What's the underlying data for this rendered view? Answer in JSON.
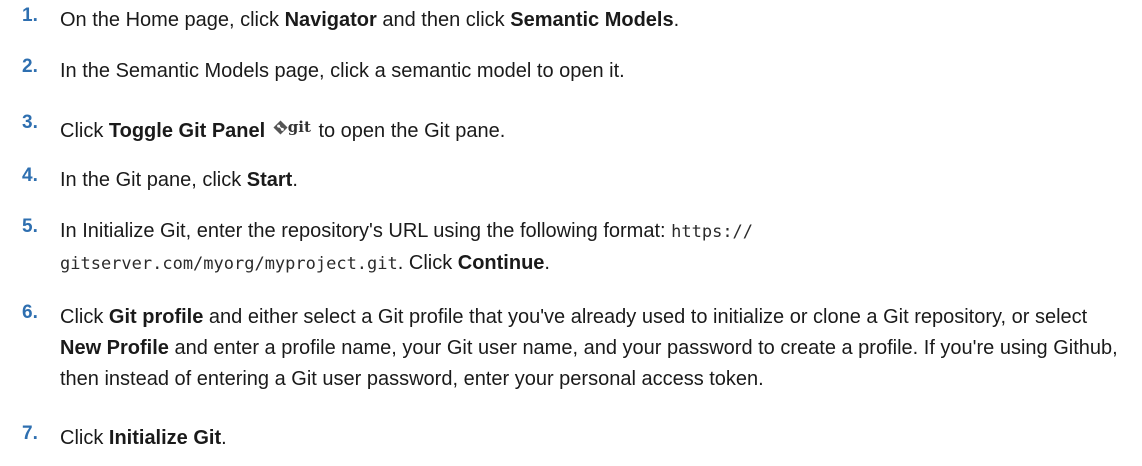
{
  "steps": [
    {
      "num": "1.",
      "parts": [
        "On the Home page, click ",
        "Navigator",
        " and then click ",
        "Semantic Models",
        "."
      ]
    },
    {
      "num": "2.",
      "text": "In the Semantic Models page, click a semantic model to open it."
    },
    {
      "num": "3.",
      "parts": [
        "Click ",
        "Toggle Git Panel",
        " to open the Git pane."
      ],
      "icon_label": "git",
      "icon": "git-diamond-icon"
    },
    {
      "num": "4.",
      "parts": [
        "In the Git pane, click ",
        "Start",
        "."
      ]
    },
    {
      "num": "5.",
      "parts": [
        "In Initialize Git, enter the repository's URL using the following format: ",
        "https://",
        "gitserver.com/myorg/myproject.git",
        ". Click ",
        "Continue",
        "."
      ]
    },
    {
      "num": "6.",
      "parts": [
        "Click ",
        "Git profile",
        " and either select a Git profile that you've already used to initialize or clone a Git repository, or select ",
        "New Profile",
        " and enter a profile name, your Git user name, and your password to create a profile. If you're using Github, then instead of entering a Git user password, enter your personal access token."
      ]
    },
    {
      "num": "7.",
      "parts": [
        "Click ",
        "Initialize Git",
        "."
      ]
    }
  ],
  "colors": {
    "number": "#2e6fb0",
    "text": "#1a1a1a"
  }
}
